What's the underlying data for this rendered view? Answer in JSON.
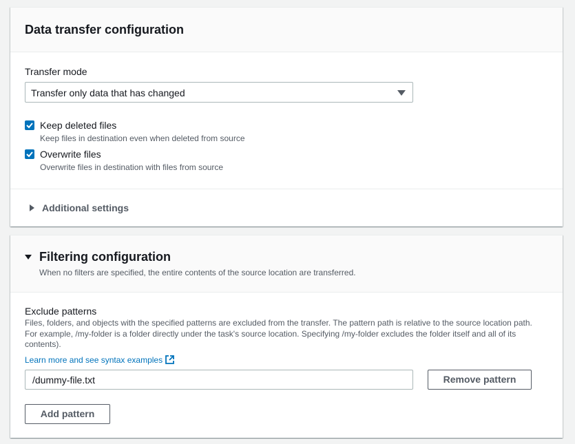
{
  "data_transfer": {
    "title": "Data transfer configuration",
    "transfer_mode_label": "Transfer mode",
    "transfer_mode_value": "Transfer only data that has changed",
    "keep_deleted": {
      "label": "Keep deleted files",
      "description": "Keep files in destination even when deleted from source",
      "checked": true
    },
    "overwrite": {
      "label": "Overwrite files",
      "description": "Overwrite files in destination with files from source",
      "checked": true
    },
    "additional_settings": "Additional settings"
  },
  "filtering": {
    "title": "Filtering configuration",
    "subtitle": "When no filters are specified, the entire contents of the source location are transferred.",
    "exclude_label": "Exclude patterns",
    "exclude_desc_1": "Files, folders, and objects with the specified patterns are excluded from the transfer. The pattern path is relative to the source location path.",
    "exclude_desc_2": "For example, /my-folder is a folder directly under the task's source location. Specifying /my-folder excludes the folder itself and all of its",
    "exclude_desc_3": "contents).",
    "learn_more": "Learn more and see syntax examples",
    "pattern_value": "/dummy-file.txt",
    "remove_button": "Remove pattern",
    "add_button": "Add pattern"
  },
  "colors": {
    "accent": "#0073bb",
    "text": "#16191f",
    "secondary_text": "#545b64"
  }
}
